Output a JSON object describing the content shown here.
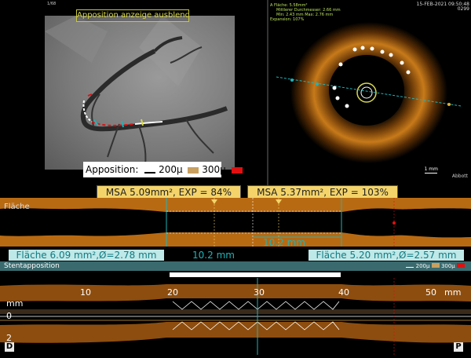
{
  "angio": {
    "title": "Apposition anzeige ausblenden",
    "frame_id": "1/68",
    "legend_label": "Apposition:",
    "legend_200": "200µ",
    "legend_300": "300µ"
  },
  "oct": {
    "stats": {
      "area": "A Fläche: 5.58mm²",
      "mean_diam": "Mittlerer Durchmesser: 2.66 mm",
      "minmax": "Min: 2.43 mm  Max: 2.76 mm",
      "expansion": "Expansion: 107%"
    },
    "date": "15-FEB-2021 09:50:48",
    "frame": "0299",
    "scale": "1 mm",
    "brand": "Abbott"
  },
  "msa": {
    "left": "MSA 5.09mm², EXP = 84%",
    "right": "MSA 5.37mm², EXP = 103%"
  },
  "area_label": "Fläche",
  "length_mid": "10.2 mm",
  "measurements": {
    "left": "Fläche 6.09 mm²,Ø=2.78 mm",
    "center": "10.2 mm",
    "right": "Fläche 5.20 mm²,Ø=2.57 mm"
  },
  "stent_bar": {
    "label": "Stentapposition",
    "legend_200": "200µ",
    "legend_300": "300µ"
  },
  "long_view": {
    "ticks": [
      "10",
      "20",
      "30",
      "40",
      "50"
    ],
    "unit": "mm",
    "y_unit": "mm",
    "y_ticks": [
      "0",
      "2"
    ],
    "dist": "D",
    "prox": "P"
  },
  "colors": {
    "accent_yellow": "#f4d46a",
    "teal": "#1fb3b8",
    "apposition_red": "#e01010",
    "apposition_tan": "#c8a060",
    "lumen_orange": "#c77a1a"
  }
}
